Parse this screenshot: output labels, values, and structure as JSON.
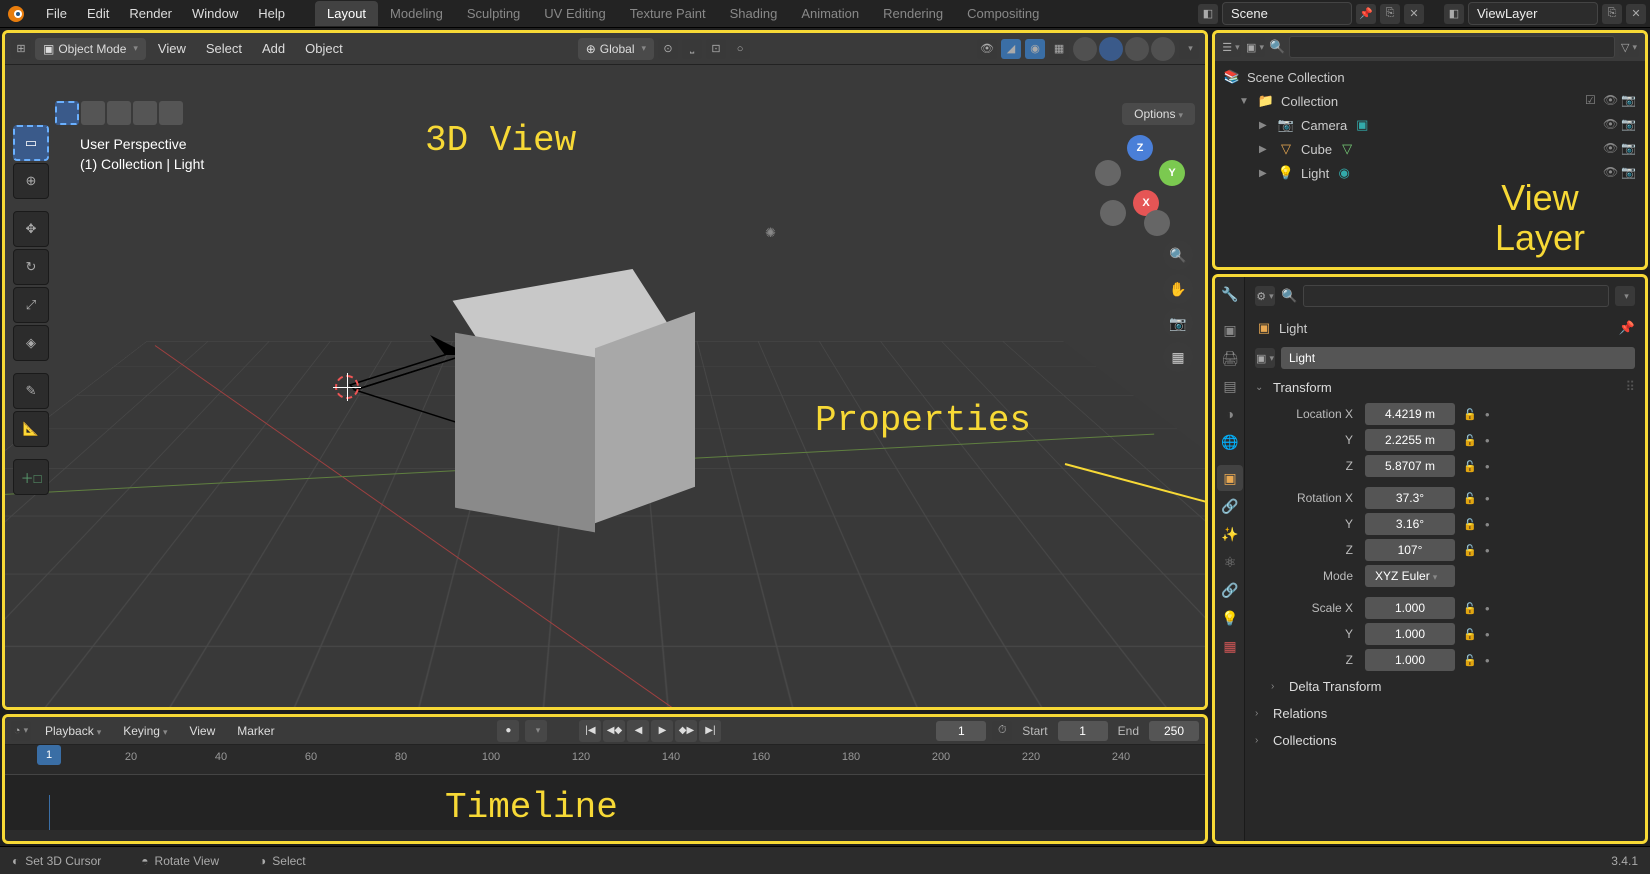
{
  "top_menu": {
    "file": "File",
    "edit": "Edit",
    "render": "Render",
    "window": "Window",
    "help": "Help"
  },
  "workspace_tabs": [
    "Layout",
    "Modeling",
    "Sculpting",
    "UV Editing",
    "Texture Paint",
    "Shading",
    "Animation",
    "Rendering",
    "Compositing"
  ],
  "scene": {
    "label": "Scene",
    "viewlayer": "ViewLayer"
  },
  "viewport": {
    "mode": "Object Mode",
    "menus": {
      "view": "View",
      "select": "Select",
      "add": "Add",
      "object": "Object"
    },
    "orientation": "Global",
    "info_line1": "User Perspective",
    "info_line2": "(1) Collection | Light",
    "options": "Options"
  },
  "annotations": {
    "view3d": "3D View",
    "properties": "Properties",
    "viewlayer_line1": "View",
    "viewlayer_line2": "Layer",
    "timeline": "Timeline"
  },
  "timeline": {
    "menus": {
      "playback": "Playback",
      "keying": "Keying",
      "view": "View",
      "marker": "Marker"
    },
    "current_frame": "1",
    "start_label": "Start",
    "start_value": "1",
    "end_label": "End",
    "end_value": "250",
    "ticks": [
      "20",
      "40",
      "60",
      "80",
      "100",
      "120",
      "140",
      "160",
      "180",
      "200",
      "220",
      "240"
    ]
  },
  "outliner": {
    "scene_collection": "Scene Collection",
    "collection": "Collection",
    "items": [
      {
        "name": "Camera",
        "icon": "📷"
      },
      {
        "name": "Cube",
        "icon": "▽"
      },
      {
        "name": "Light",
        "icon": "💡"
      }
    ]
  },
  "properties": {
    "breadcrumb": "Light",
    "object_name": "Light",
    "transform_label": "Transform",
    "location": {
      "x_label": "Location X",
      "y_label": "Y",
      "z_label": "Z",
      "x": "4.4219 m",
      "y": "2.2255 m",
      "z": "5.8707 m"
    },
    "rotation": {
      "x_label": "Rotation X",
      "y_label": "Y",
      "z_label": "Z",
      "x": "37.3°",
      "y": "3.16°",
      "z": "107°"
    },
    "mode": {
      "label": "Mode",
      "value": "XYZ Euler"
    },
    "scale": {
      "x_label": "Scale X",
      "y_label": "Y",
      "z_label": "Z",
      "x": "1.000",
      "y": "1.000",
      "z": "1.000"
    },
    "delta_transform": "Delta Transform",
    "relations": "Relations",
    "collections": "Collections"
  },
  "status_bar": {
    "set_cursor": "Set 3D Cursor",
    "rotate_view": "Rotate View",
    "select": "Select",
    "version": "3.4.1"
  }
}
